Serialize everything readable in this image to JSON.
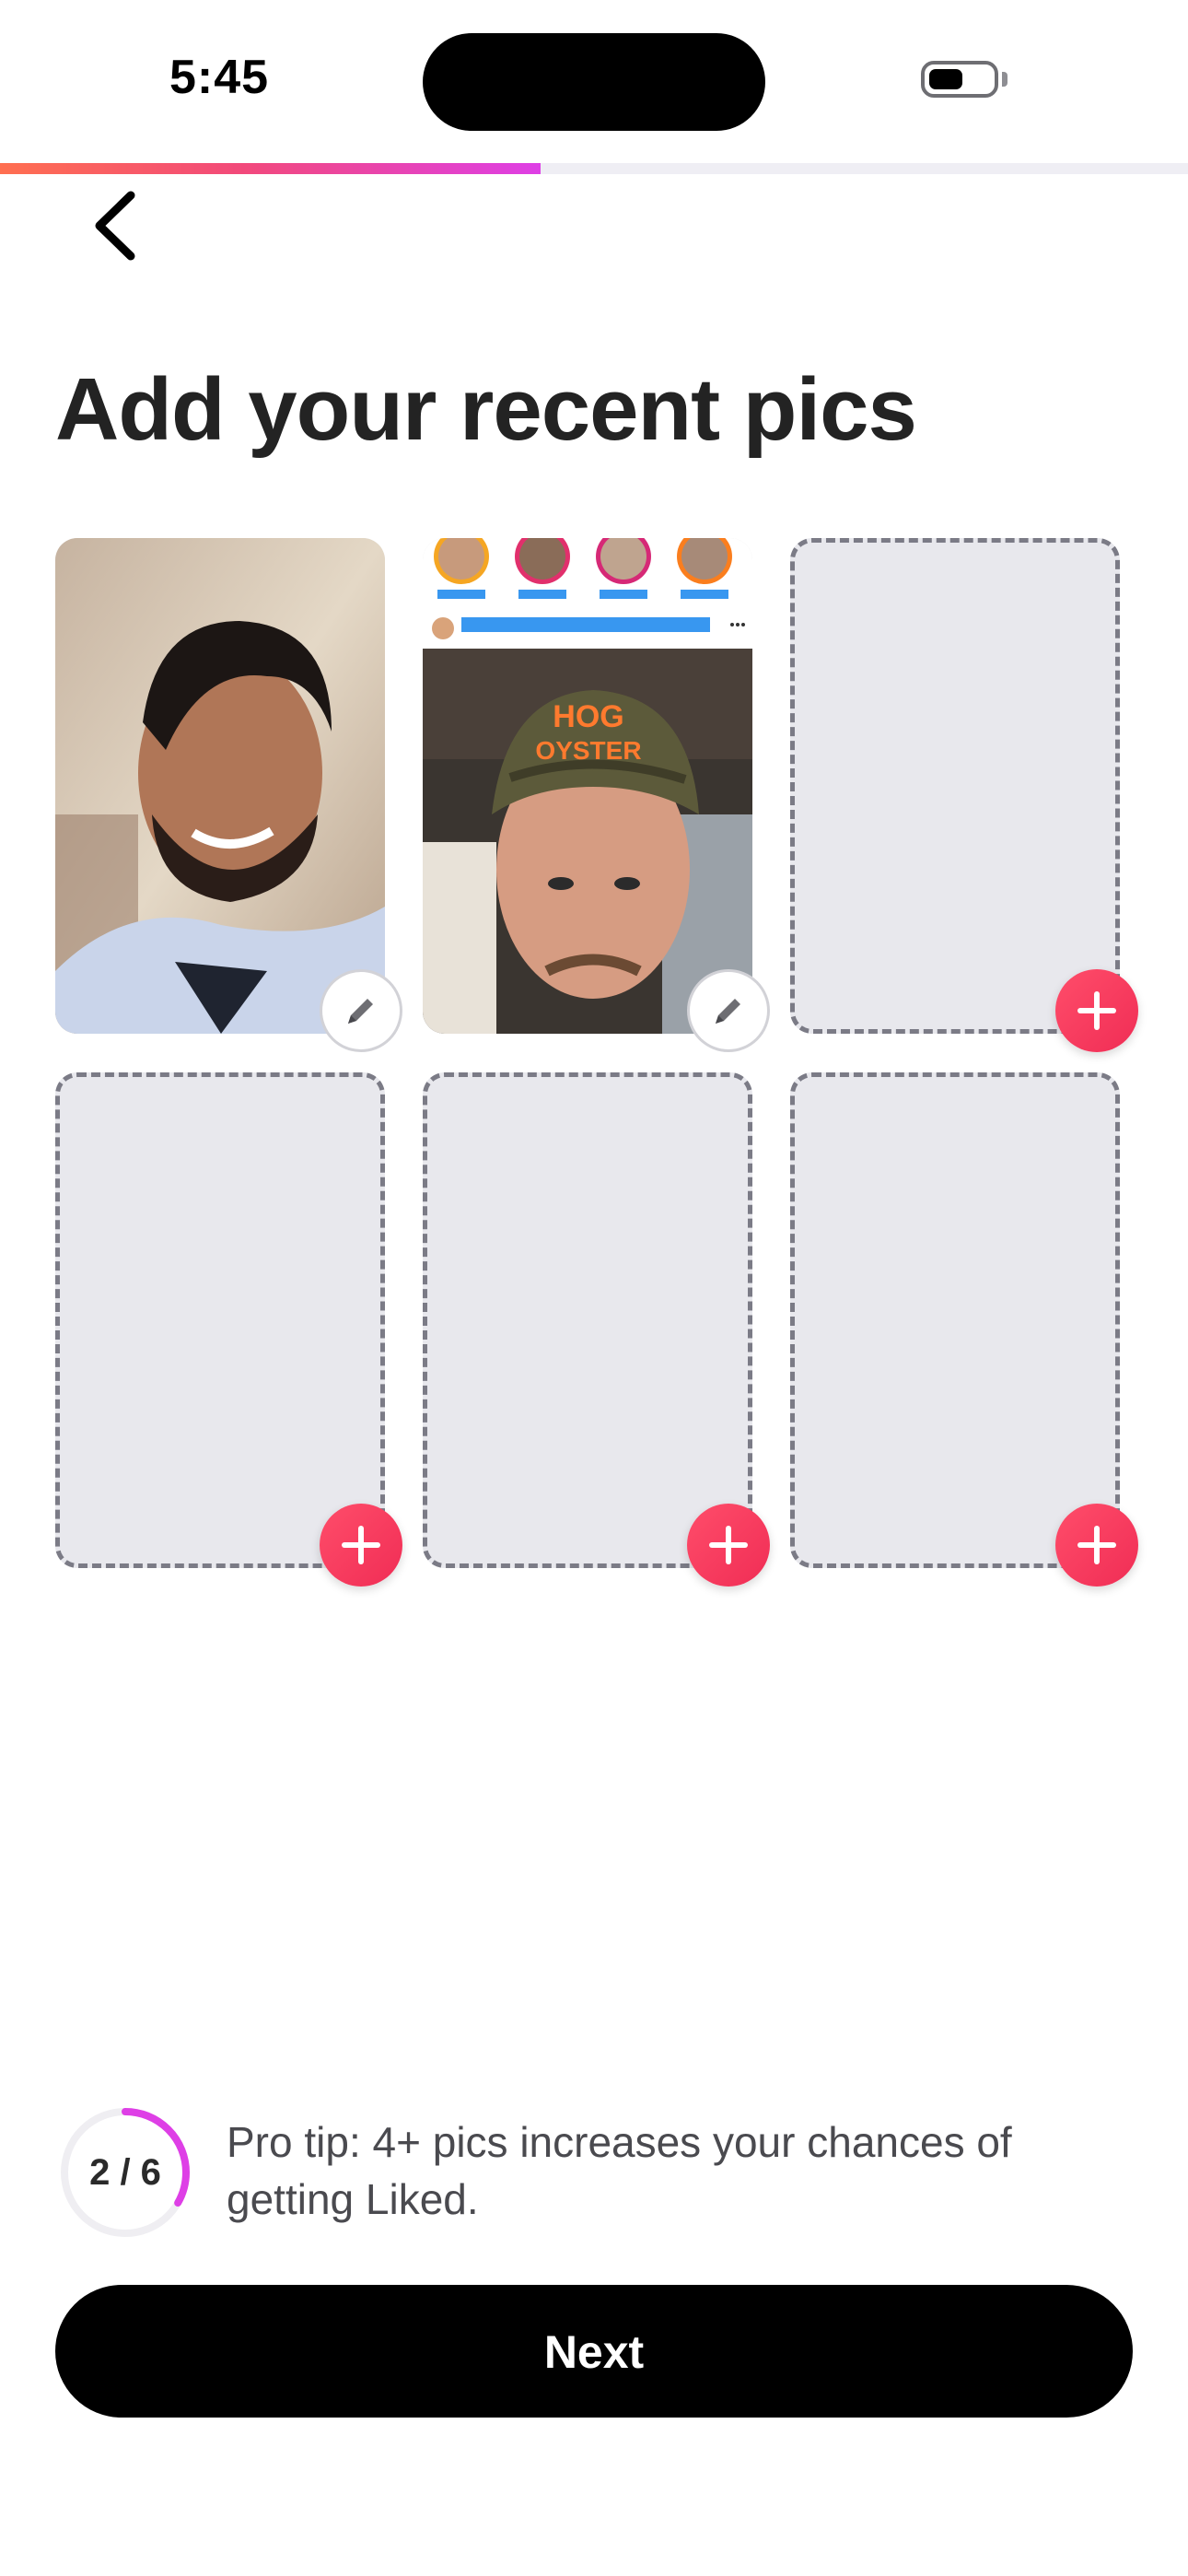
{
  "status_bar": {
    "time": "5:45"
  },
  "onboarding": {
    "progress_fraction": 0.455
  },
  "page": {
    "title": "Add your recent pics"
  },
  "photos": {
    "slots": [
      {
        "state": "filled",
        "action_icon": "pencil-icon"
      },
      {
        "state": "filled",
        "action_icon": "pencil-icon"
      },
      {
        "state": "empty",
        "action_icon": "plus-icon"
      },
      {
        "state": "empty",
        "action_icon": "plus-icon"
      },
      {
        "state": "empty",
        "action_icon": "plus-icon"
      },
      {
        "state": "empty",
        "action_icon": "plus-icon"
      }
    ],
    "count_label": "2 / 6",
    "count": 2,
    "max": 6
  },
  "tip": {
    "text": "Pro tip: 4+ pics increases your chances of getting Liked."
  },
  "footer": {
    "next_label": "Next"
  },
  "colors": {
    "accent_pink": "#f02d55",
    "progress_end": "#de3fe6",
    "button_bg": "#000000"
  }
}
